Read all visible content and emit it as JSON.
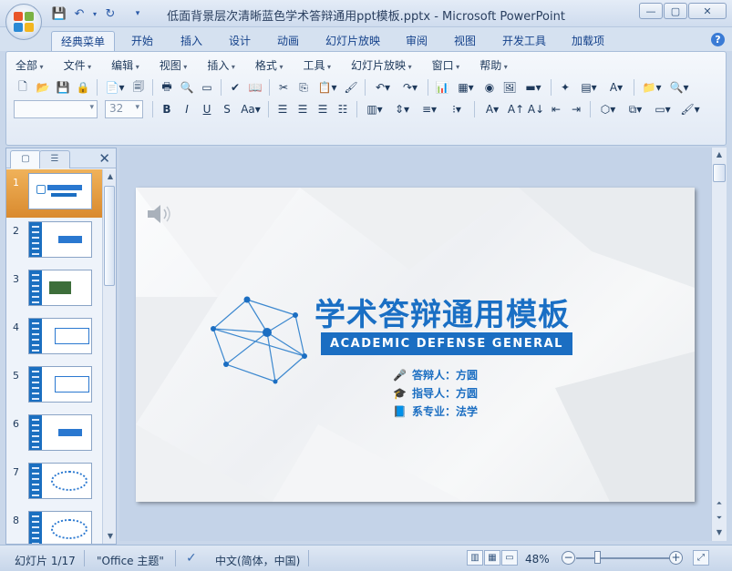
{
  "window": {
    "title": "低面背景层次清晰蓝色学术答辩通用ppt模板.pptx - Microsoft PowerPoint"
  },
  "ribbon_tabs": [
    "经典菜单",
    "开始",
    "插入",
    "设计",
    "动画",
    "幻灯片放映",
    "审阅",
    "视图",
    "开发工具",
    "加载项"
  ],
  "menu_bar": [
    "全部",
    "文件",
    "编辑",
    "视图",
    "插入",
    "格式",
    "工具",
    "幻灯片放映",
    "窗口",
    "帮助"
  ],
  "font_size": "32",
  "slide_panel": {
    "slide_numbers": [
      "1",
      "2",
      "3",
      "4",
      "5",
      "6",
      "7",
      "8"
    ],
    "active_index": 0
  },
  "slide": {
    "title": "学术答辩通用模板",
    "subtitle": "ACADEMIC DEFENSE GENERAL",
    "info": [
      {
        "icon": "microphone-icon",
        "text": "答辩人：方圆"
      },
      {
        "icon": "graduation-cap-icon",
        "text": "指导人：方圆"
      },
      {
        "icon": "book-icon",
        "text": "系专业：法学"
      }
    ]
  },
  "status": {
    "slide_info": "幻灯片 1/17",
    "theme": "\"Office 主题\"",
    "language": "中文(简体，中国)",
    "zoom": "48%"
  },
  "colors": {
    "accent": "#1b6ec2",
    "active_thumb": "#e38b2a"
  }
}
